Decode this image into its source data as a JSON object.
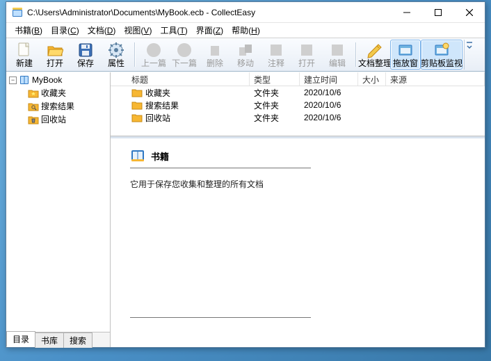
{
  "window": {
    "title": "C:\\Users\\Administrator\\Documents\\MyBook.ecb - CollectEasy"
  },
  "menu": {
    "book": {
      "label": "书籍",
      "mnemonic": "B"
    },
    "catalog": {
      "label": "目录",
      "mnemonic": "C"
    },
    "doc": {
      "label": "文档",
      "mnemonic": "D"
    },
    "view": {
      "label": "视图",
      "mnemonic": "V"
    },
    "tool": {
      "label": "工具",
      "mnemonic": "T"
    },
    "ui": {
      "label": "界面",
      "mnemonic": "Z"
    },
    "help": {
      "label": "帮助",
      "mnemonic": "H"
    }
  },
  "toolbar": {
    "new": "新建",
    "open": "打开",
    "save": "保存",
    "prop": "属性",
    "prev": "上一篇",
    "next": "下一篇",
    "delete": "删除",
    "move": "移动",
    "annotate": "注释",
    "open2": "打开",
    "edit": "编辑",
    "docorg": "文档整理",
    "dragwin": "拖放窗",
    "clipmon": "剪贴板监视"
  },
  "tree": {
    "root": "MyBook",
    "items": [
      {
        "label": "收藏夹",
        "icon": "favorites-folder-icon"
      },
      {
        "label": "搜索结果",
        "icon": "search-folder-icon"
      },
      {
        "label": "回收站",
        "icon": "recycle-folder-icon"
      }
    ]
  },
  "sideTabs": {
    "t0": "目录",
    "t1": "书库",
    "t2": "搜索"
  },
  "list": {
    "columns": {
      "title": "标题",
      "type": "类型",
      "time": "建立时间",
      "size": "大小",
      "source": "来源"
    },
    "rows": [
      {
        "title": "收藏夹",
        "type": "文件夹",
        "time": "2020/10/6",
        "size": "",
        "source": "",
        "icon": "favorites-folder-icon"
      },
      {
        "title": "搜索结果",
        "type": "文件夹",
        "time": "2020/10/6",
        "size": "",
        "source": "",
        "icon": "search-folder-icon"
      },
      {
        "title": "回收站",
        "type": "文件夹",
        "time": "2020/10/6",
        "size": "",
        "source": "",
        "icon": "recycle-folder-icon"
      }
    ]
  },
  "detail": {
    "title": "书籍",
    "desc": "它用于保存您收集和整理的所有文档"
  }
}
